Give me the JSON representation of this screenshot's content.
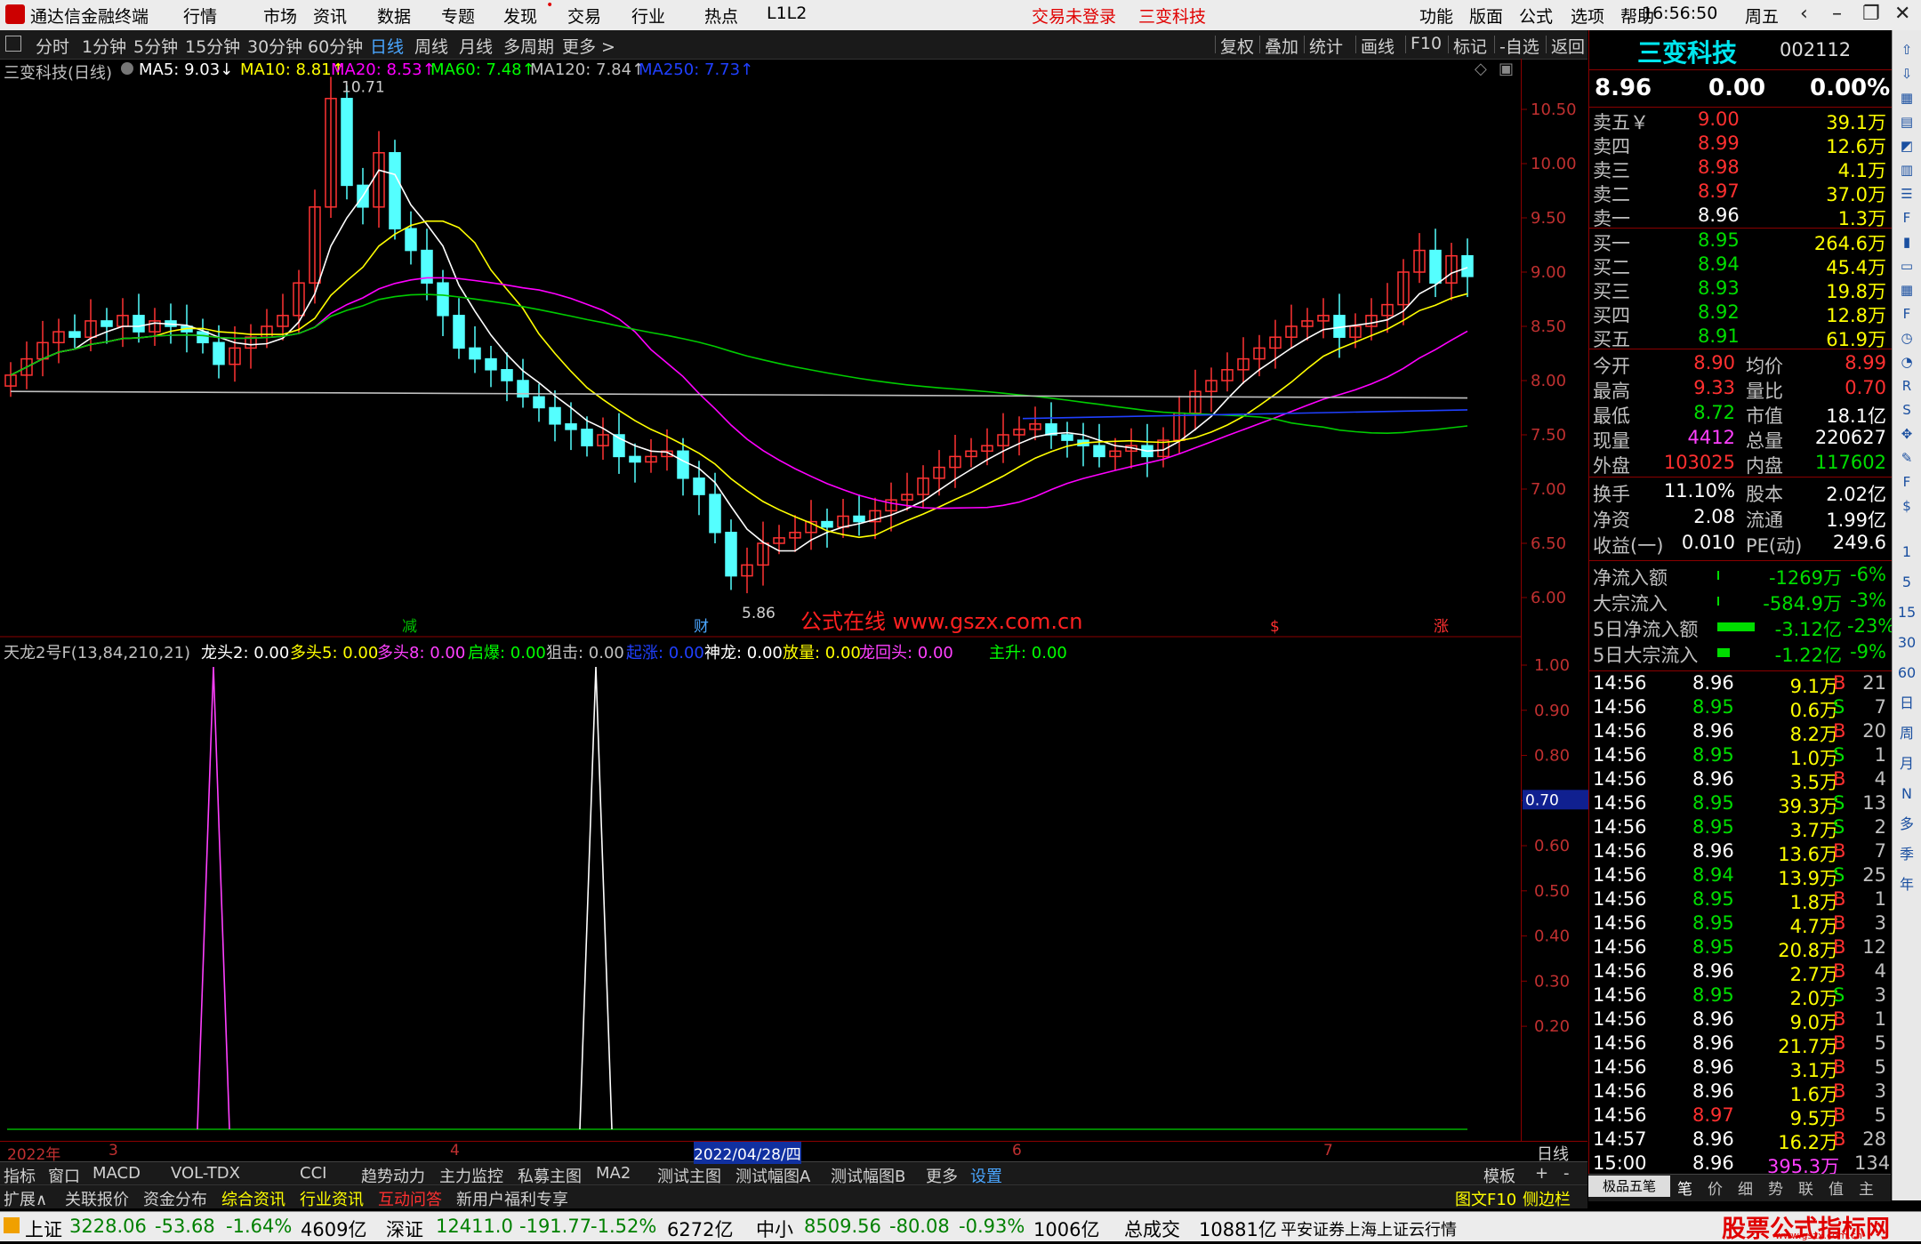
{
  "menubar": {
    "app_title": "通达信金融终端",
    "menu": [
      "行情",
      "市场",
      "资讯",
      "数据",
      "专题",
      "发现",
      "交易",
      "行业",
      "热点",
      "L1L2"
    ],
    "center_red": [
      "交易未登录",
      "三变科技"
    ],
    "right_menu": [
      "功能",
      "版面",
      "公式",
      "选项",
      "帮助"
    ],
    "clock": "16:56:50",
    "weekday": "周五"
  },
  "periodbar": {
    "periods": [
      "分时",
      "1分钟",
      "5分钟",
      "15分钟",
      "30分钟",
      "60分钟",
      "日线",
      "周线",
      "月线",
      "多周期",
      "更多 >"
    ],
    "active": "日线",
    "tools": [
      "复权",
      "叠加",
      "统计",
      "画线",
      "F10",
      "标记",
      "-自选",
      "返回"
    ]
  },
  "main_legend": {
    "title": "三变科技(日线)",
    "ma": [
      {
        "label": "MA5: 9.03↓",
        "color": "#ffffff"
      },
      {
        "label": "MA10: 8.81↑",
        "color": "#ffff00"
      },
      {
        "label": "MA20: 8.53↑",
        "color": "#ff00ff"
      },
      {
        "label": "MA60: 7.48↑",
        "color": "#00ff00"
      },
      {
        "label": "MA120: 7.84↑",
        "color": "#c0c0c0"
      },
      {
        "label": "MA250: 7.73↑",
        "color": "#2040ff"
      }
    ]
  },
  "price_axis": [
    "10.50",
    "10.00",
    "9.50",
    "9.00",
    "8.50",
    "8.00",
    "7.50",
    "7.00",
    "6.50",
    "6.00"
  ],
  "annotations": {
    "high": "10.71",
    "low": "5.86",
    "watermark": "公式在线  www.gszx.com.cn",
    "markers": [
      "减",
      "财",
      "$",
      "涨"
    ]
  },
  "ind_legend": [
    {
      "label": "天龙2号F(13,84,210,21)",
      "color": "#c0c0c0"
    },
    {
      "label": "龙头2: 0.00",
      "color": "#ffffff"
    },
    {
      "label": "多头5: 0.00",
      "color": "#ffff00"
    },
    {
      "label": "多头8: 0.00",
      "color": "#ff40ff"
    },
    {
      "label": "启爆: 0.00",
      "color": "#00ff00"
    },
    {
      "label": "狙击: 0.00",
      "color": "#c0c0c0"
    },
    {
      "label": "起涨: 0.00",
      "color": "#2040ff"
    },
    {
      "label": "神龙: 0.00",
      "color": "#ffffff"
    },
    {
      "label": "放量: 0.00",
      "color": "#ffff00"
    },
    {
      "label": "龙回头: 0.00",
      "color": "#ff40ff"
    },
    {
      "label": "主升: 0.00",
      "color": "#00ff00"
    }
  ],
  "ind_axis": [
    "1.00",
    "0.90",
    "0.80",
    "0.70",
    "0.60",
    "0.50",
    "0.40",
    "0.30",
    "0.20"
  ],
  "ind_marker": "0.70",
  "date_axis": {
    "items": [
      "2022年",
      "3",
      "4",
      "2022/04/28/四",
      "6",
      "7"
    ],
    "right": "日线"
  },
  "tabs1": [
    "指标",
    "窗口",
    "MACD",
    "VOL-TDX",
    "CCI",
    "趋势动力",
    "主力监控",
    "私募主图",
    "MA2",
    "测试主图",
    "测试幅图A",
    "测试幅图B",
    "更多",
    "设置"
  ],
  "tabs1_right": [
    "模板",
    "+",
    "-"
  ],
  "tabs2": [
    "扩展∧",
    "关联报价",
    "资金分布",
    "综合资讯",
    "行业资讯",
    "互动问答",
    "新用户福利专享"
  ],
  "tabs2_right": [
    "图文F10",
    "侧边栏"
  ],
  "quote": {
    "name": "三变科技",
    "code": "002112",
    "price": "8.96",
    "change": "0.00",
    "pct": "0.00%",
    "asks": [
      {
        "label": "卖五￥",
        "price": "9.00",
        "vol": "39.1万"
      },
      {
        "label": "卖四",
        "price": "8.99",
        "vol": "12.6万"
      },
      {
        "label": "卖三",
        "price": "8.98",
        "vol": "4.1万"
      },
      {
        "label": "卖二",
        "price": "8.97",
        "vol": "37.0万"
      },
      {
        "label": "卖一",
        "price": "8.96",
        "vol": "1.3万"
      }
    ],
    "bids": [
      {
        "label": "买一",
        "price": "8.95",
        "vol": "264.6万"
      },
      {
        "label": "买二",
        "price": "8.94",
        "vol": "45.4万"
      },
      {
        "label": "买三",
        "price": "8.93",
        "vol": "19.8万"
      },
      {
        "label": "买四",
        "price": "8.92",
        "vol": "12.8万"
      },
      {
        "label": "买五",
        "price": "8.91",
        "vol": "61.9万"
      }
    ],
    "stats": [
      [
        "今开",
        "8.90",
        "均价",
        "8.99"
      ],
      [
        "最高",
        "9.33",
        "量比",
        "0.70"
      ],
      [
        "最低",
        "8.72",
        "市值",
        "18.1亿"
      ],
      [
        "现量",
        "4412",
        "总量",
        "220627"
      ],
      [
        "外盘",
        "103025",
        "内盘",
        "117602"
      ]
    ],
    "stats2": [
      [
        "换手",
        "11.10%",
        "股本",
        "2.02亿"
      ],
      [
        "净资",
        "2.08",
        "流通",
        "1.99亿"
      ],
      [
        "收益(一)",
        "0.010",
        "PE(动)",
        "249.6"
      ]
    ],
    "flows": [
      {
        "label": "净流入额",
        "val": "-1269万",
        "pct": "-6%",
        "bar": 0.02
      },
      {
        "label": "大宗流入",
        "val": "-584.9万",
        "pct": "-3%",
        "bar": 0.01
      },
      {
        "label": "5日净流入额",
        "val": "-3.12亿",
        "pct": "-23%",
        "bar": 0.35
      },
      {
        "label": "5日大宗流入",
        "val": "-1.22亿",
        "pct": "-9%",
        "bar": 0.12
      }
    ]
  },
  "ticks": [
    [
      "14:56",
      "8.96",
      "9.1万",
      "B",
      "21"
    ],
    [
      "14:56",
      "8.95",
      "0.6万",
      "S",
      "7"
    ],
    [
      "14:56",
      "8.96",
      "8.2万",
      "B",
      "20"
    ],
    [
      "14:56",
      "8.95",
      "1.0万",
      "S",
      "1"
    ],
    [
      "14:56",
      "8.96",
      "3.5万",
      "B",
      "4"
    ],
    [
      "14:56",
      "8.95",
      "39.3万",
      "S",
      "13"
    ],
    [
      "14:56",
      "8.95",
      "3.7万",
      "S",
      "2"
    ],
    [
      "14:56",
      "8.96",
      "13.6万",
      "B",
      "7"
    ],
    [
      "14:56",
      "8.94",
      "13.9万",
      "S",
      "25"
    ],
    [
      "14:56",
      "8.95",
      "1.8万",
      "B",
      "1"
    ],
    [
      "14:56",
      "8.95",
      "4.7万",
      "B",
      "3"
    ],
    [
      "14:56",
      "8.95",
      "20.8万",
      "B",
      "12"
    ],
    [
      "14:56",
      "8.96",
      "2.7万",
      "B",
      "4"
    ],
    [
      "14:56",
      "8.95",
      "2.0万",
      "S",
      "3"
    ],
    [
      "14:56",
      "8.96",
      "9.0万",
      "B",
      "1"
    ],
    [
      "14:56",
      "8.96",
      "21.7万",
      "B",
      "5"
    ],
    [
      "14:56",
      "8.96",
      "3.1万",
      "B",
      "5"
    ],
    [
      "14:56",
      "8.96",
      "1.6万",
      "B",
      "3"
    ],
    [
      "14:56",
      "8.97",
      "9.5万",
      "B",
      "5"
    ],
    [
      "14:57",
      "8.96",
      "16.2万",
      "B",
      "28"
    ],
    [
      "15:00",
      "8.96",
      "395.3万",
      "",
      "134"
    ]
  ],
  "panel_tabs": [
    "笔",
    "价",
    "细",
    "势",
    "联",
    "值",
    "主"
  ],
  "panel_tool": "极品五笔",
  "statusbar": {
    "sh": {
      "name": "上证",
      "val": "3228.06",
      "chg": "-53.68",
      "pct": "-1.64%",
      "amt": "4609亿"
    },
    "sz": {
      "name": "深证",
      "val": "12411.0",
      "chg": "-191.77",
      "pct": "-1.52%",
      "amt": "6272亿"
    },
    "zx": {
      "name": "中小",
      "val": "8509.56",
      "chg": "-80.08",
      "pct": "-0.93%",
      "amt": "1006亿"
    },
    "total_label": "总成交",
    "total": "10881亿",
    "cloud": "平安证券上海上证云行情",
    "brand": "股票公式指标网",
    "brand_url": "www.gszx.com.cn"
  },
  "icon_strip": [
    "arrow-up-icon",
    "arrow-down-icon",
    "grid-icon",
    "table-icon",
    "chart-icon",
    "candle-icon",
    "list-icon",
    "f10-icon",
    "bars-icon",
    "doc-icon",
    "grid2-icon",
    "fs-icon",
    "clock-icon",
    "tick-icon",
    "rsi-icon",
    "s-icon",
    "move-icon",
    "pen-icon",
    "fs2-icon",
    "money-icon"
  ],
  "icon_strip_text": [
    "1",
    "5",
    "15",
    "30",
    "60",
    "日",
    "周",
    "月",
    "N",
    "多",
    "季",
    "年"
  ]
}
